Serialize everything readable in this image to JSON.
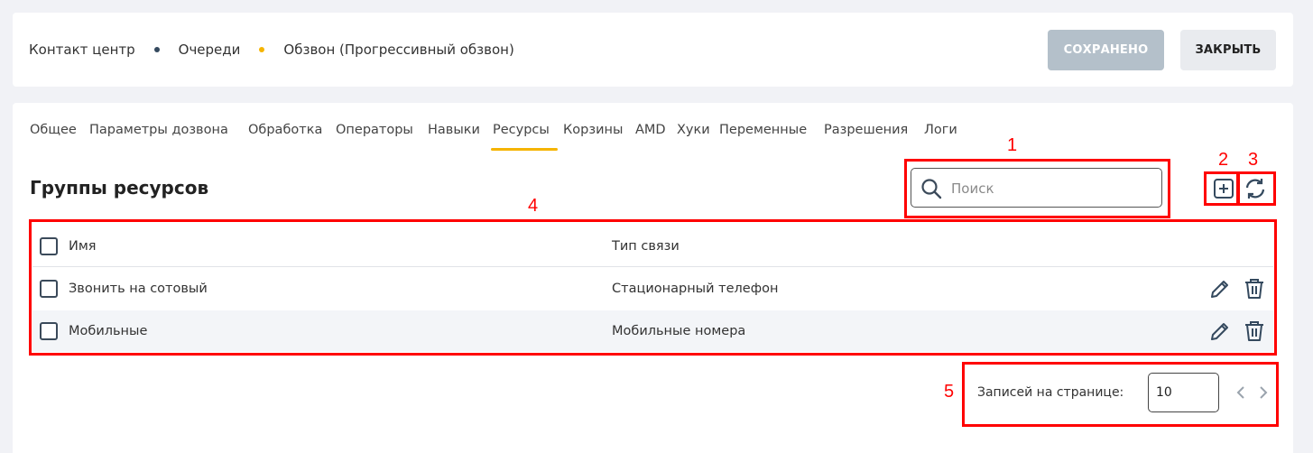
{
  "breadcrumb": {
    "items": [
      "Контакт центр",
      "Очереди",
      "Обзвон (Прогрессивный обзвон)"
    ],
    "dot_colors": [
      "#34495e",
      "#f5b400"
    ]
  },
  "header": {
    "saved_label": "СОХРАНЕНО",
    "close_label": "ЗАКРЫТЬ"
  },
  "tabs": {
    "items": [
      "Общее",
      "Параметры дозвона",
      "Обработка",
      "Операторы",
      "Навыки",
      "Ресурсы",
      "Корзины",
      "AMD",
      "Хуки",
      "Переменные",
      "Разрешения",
      "Логи"
    ],
    "active": "Ресурсы",
    "accent_color": "#f5b400"
  },
  "section": {
    "title": "Группы ресурсов"
  },
  "search": {
    "placeholder": "Поиск",
    "value": ""
  },
  "toolbar": {
    "add_icon": "plus-square-icon",
    "refresh_icon": "refresh-icon"
  },
  "table": {
    "columns": [
      "Имя",
      "Тип связи"
    ],
    "rows": [
      {
        "name": "Звонить на сотовый",
        "type": "Стационарный телефон"
      },
      {
        "name": "Мобильные",
        "type": "Мобильные номера"
      }
    ],
    "row_actions": [
      "pencil-icon",
      "trash-icon"
    ]
  },
  "pagination": {
    "label": "Записей на странице:",
    "page_size": "10"
  },
  "annotations": {
    "labels": [
      "1",
      "2",
      "3",
      "4",
      "5"
    ],
    "color": "#ff0000"
  }
}
